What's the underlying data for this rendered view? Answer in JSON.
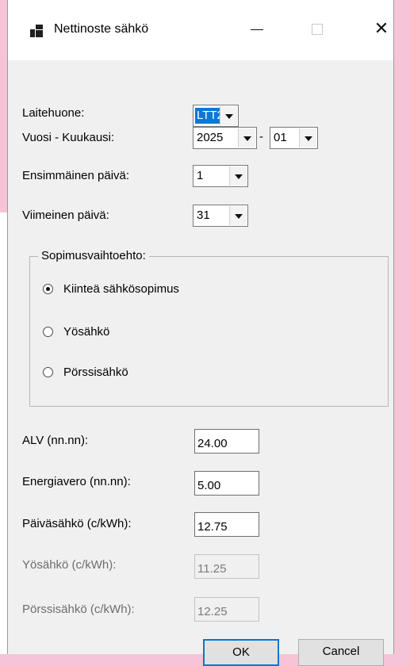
{
  "window": {
    "title": "Nettinoste sähkö",
    "min_icon": "minimize-icon",
    "max_icon": "maximize-icon",
    "close_icon": "close-icon",
    "close_glyph": "✕"
  },
  "fields": {
    "laitehuone_label": "Laitehuone:",
    "laitehuone_value": "LTT2",
    "vuosi_label": "Vuosi - Kuukausi:",
    "vuosi_value": "2025",
    "separator": "-",
    "kuukausi_value": "01",
    "ensimmainen_label": "Ensimmäinen päivä:",
    "ensimmainen_value": "1",
    "viimeinen_label": "Viimeinen päivä:",
    "viimeinen_value": "31"
  },
  "group": {
    "title": "Sopimusvaihtoehto:",
    "options": [
      {
        "label": "Kiinteä sähkösopimus",
        "selected": true
      },
      {
        "label": "Yösähkö",
        "selected": false
      },
      {
        "label": "Pörssisähkö",
        "selected": false
      }
    ]
  },
  "inputs": {
    "alv_label": "ALV (nn.nn):",
    "alv_value": "24.00",
    "energiavero_label": "Energiavero (nn.nn):",
    "energiavero_value": "5.00",
    "paivasahko_label": "Päiväsähkö (c/kWh):",
    "paivasahko_value": "12.75",
    "yosahko_label": "Yösähkö (c/kWh):",
    "yosahko_value": "11.25",
    "porssisahko_label": "Pörssisähkö (c/kWh):",
    "porssisahko_value": "12.25"
  },
  "buttons": {
    "ok_label": "OK",
    "cancel_label": "Cancel"
  },
  "colors": {
    "background_pink": "#f6c4d6",
    "window_bg": "#f0f0f0",
    "selection_blue": "#0a78d7",
    "focus_border": "#0078d7"
  }
}
